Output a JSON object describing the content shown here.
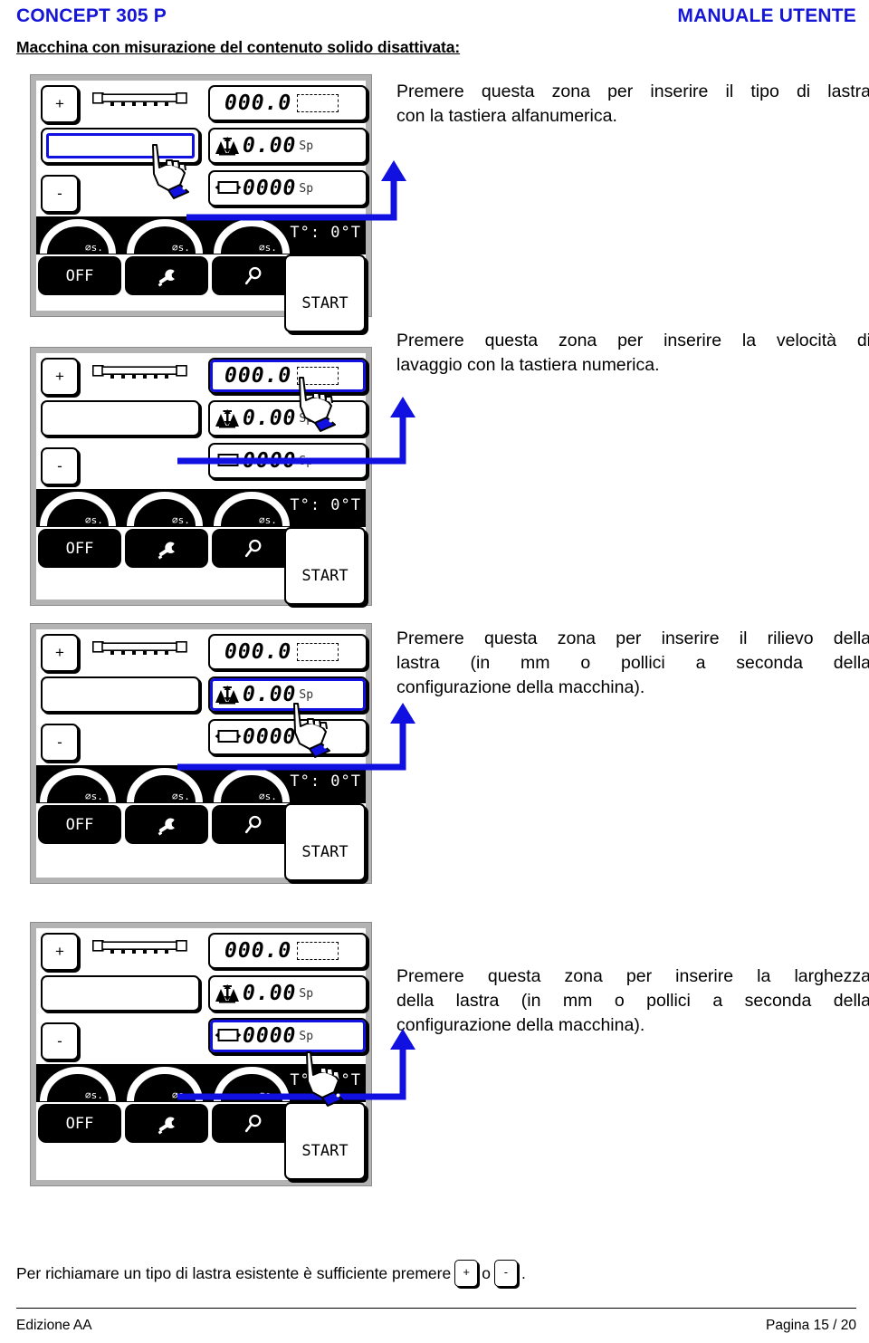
{
  "header": {
    "left": "CONCEPT 305 P",
    "right": "MANUALE UTENTE",
    "accent_color": "#1616d6"
  },
  "section_title": "Macchina con misurazione del contenuto solido disattivata:",
  "panel_common": {
    "plus_label": "+",
    "minus_label": "-",
    "rack_icon": "rack-bar-icon",
    "display_top_value": "000.0",
    "display_mid_icon": "plate-thickness-icon",
    "display_mid_value": "0.00",
    "display_mid_unit": "Sp",
    "display_bot_icon": "plate-width-icon",
    "display_bot_value": "0000",
    "display_bot_unit": "Sp",
    "gauge_label": "⌀s.",
    "temperature_label": "T°: 0°T",
    "btn_off": "OFF",
    "btn_service_icon": "wrench-icon",
    "btn_search_icon": "magnifier-icon",
    "btn_start": "START"
  },
  "blocks": [
    {
      "id": "block-plate-type",
      "selected": "name-field",
      "text_lines": [
        "Premere questa zona per inserire il tipo di lastra",
        "con la tastiera alfanumerica."
      ]
    },
    {
      "id": "block-wash-speed",
      "selected": "display-top",
      "text_lines": [
        "Premere questa zona per inserire la velocità di",
        "lavaggio con la tastiera numerica."
      ]
    },
    {
      "id": "block-plate-relief",
      "selected": "display-mid",
      "text_lines": [
        "Premere questa zona per inserire il rilievo della",
        "lastra (in mm o pollici a seconda della",
        "configurazione della macchina)."
      ]
    },
    {
      "id": "block-plate-width",
      "selected": "display-bot",
      "text_lines": [
        "Premere questa zona per inserire la larghezza",
        "della lastra (in mm o pollici a seconda della",
        "configurazione della macchina)."
      ]
    }
  ],
  "footer_note": {
    "prefix": "Per richiamare un tipo di lastra esistente è sufficiente premere",
    "key_plus": "+",
    "conjunction": "o",
    "key_minus": "-",
    "suffix": "."
  },
  "footer": {
    "left": "Edizione AA",
    "right": "Pagina 15 / 20"
  }
}
